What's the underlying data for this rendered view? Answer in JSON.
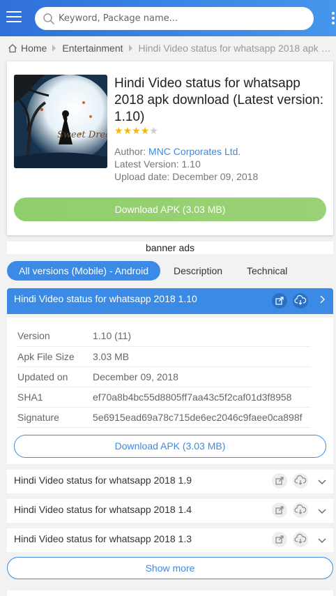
{
  "search": {
    "placeholder": "Keyword, Package name..."
  },
  "breadcrumb": {
    "home": "Home",
    "category": "Entertainment",
    "current": "Hindi Video status for whatsapp 2018 apk download"
  },
  "app": {
    "title": "Hindi Video status for whatsapp 2018 apk download (Latest version: 1.10)",
    "rating_stars": 4,
    "rating_max": 5,
    "author_label": "Author:",
    "author": "MNC Corporates Ltd.",
    "latest_version": "Latest Version: 1.10",
    "upload_date": "Upload date: December 09, 2018",
    "download_label": "Download APK (3.03 MB)",
    "icon_text": "Sweet Dreams"
  },
  "banner": "banner ads",
  "tabs": {
    "all_versions": "All versions (Mobile) - Android",
    "description": "Description",
    "technical": "Technical"
  },
  "versions": {
    "open": {
      "title": "Hindi Video status for whatsapp 2018 1.10"
    },
    "details": [
      {
        "key": "Version",
        "value": "1.10 (11)"
      },
      {
        "key": "Apk File Size",
        "value": "3.03 MB"
      },
      {
        "key": "Updated on",
        "value": "December 09, 2018"
      },
      {
        "key": "SHA1",
        "value": "ef70a8b4bc55d8805ff7aa43c5f2caf01d3f8958"
      },
      {
        "key": "Signature",
        "value": "5e6915ead69a78c715de6ec2046c9faee0ca898f"
      }
    ],
    "download_label": "Download APK (3.03 MB)",
    "collapsed": [
      {
        "title": "Hindi Video status for whatsapp 2018 1.9"
      },
      {
        "title": "Hindi Video status for whatsapp 2018 1.4"
      },
      {
        "title": "Hindi Video status for whatsapp 2018 1.3"
      }
    ]
  },
  "show_more": "Show more",
  "colors": {
    "primary": "#3a8ae6",
    "download_green": "#8fcf6b",
    "star": "#f0b90b"
  },
  "icons": [
    "menu-icon",
    "search-icon",
    "more-vertical-icon",
    "home-icon",
    "external-link-icon",
    "cloud-download-icon",
    "chevron-right-icon",
    "chevron-down-icon",
    "star-icon"
  ]
}
